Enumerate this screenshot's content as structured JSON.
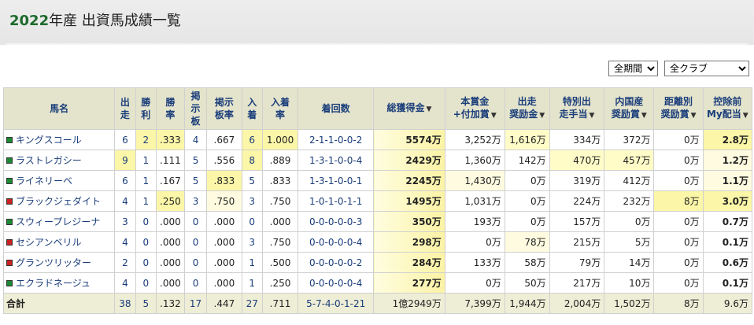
{
  "title": {
    "year": "2022",
    "rest": "年産 出資馬成績一覧"
  },
  "filters": {
    "period": "全期間",
    "club": "全クラブ"
  },
  "headers": [
    {
      "l1": "馬名",
      "l2": ""
    },
    {
      "l1": "出",
      "l2": "走"
    },
    {
      "l1": "勝",
      "l2": "利"
    },
    {
      "l1": "勝",
      "l2": "率"
    },
    {
      "l1": "掲",
      "l2": "示",
      "l3": "板"
    },
    {
      "l1": "掲示",
      "l2": "板率"
    },
    {
      "l1": "入",
      "l2": "着"
    },
    {
      "l1": "入着",
      "l2": "率"
    },
    {
      "l1": "着回数",
      "l2": ""
    },
    {
      "l1": "総獲得金",
      "l2": ""
    },
    {
      "l1": "本賞金",
      "l2": "+付加賞"
    },
    {
      "l1": "出走",
      "l2": "奨励金"
    },
    {
      "l1": "特別出",
      "l2": "走手当"
    },
    {
      "l1": "内国産",
      "l2": "奨励賞"
    },
    {
      "l1": "距離別",
      "l2": "奨励賞"
    },
    {
      "l1": "控除前",
      "l2": "My配当"
    }
  ],
  "sort_mark": "▼",
  "rows": [
    {
      "color": "g",
      "name": "キングスコール",
      "starts": "6",
      "wins": "2",
      "winrate": ".333",
      "board": "4",
      "boardrate": ".667",
      "placed": "6",
      "placerate": "1.000",
      "record": "2-1-1-0-0-2",
      "total": "5574万",
      "prize": "3,252万",
      "start_bonus": "1,616万",
      "special": "334万",
      "domestic": "372万",
      "distance": "0万",
      "dividend": "2.8万"
    },
    {
      "color": "g",
      "name": "ラストレガシー",
      "starts": "9",
      "wins": "1",
      "winrate": ".111",
      "board": "5",
      "boardrate": ".556",
      "placed": "8",
      "placerate": ".889",
      "record": "1-3-1-0-0-4",
      "total": "2429万",
      "prize": "1,360万",
      "start_bonus": "142万",
      "special": "470万",
      "domestic": "457万",
      "distance": "0万",
      "dividend": "1.2万"
    },
    {
      "color": "g",
      "name": "ライネリーベ",
      "starts": "6",
      "wins": "1",
      "winrate": ".167",
      "board": "5",
      "boardrate": ".833",
      "placed": "5",
      "placerate": ".833",
      "record": "1-3-1-0-0-1",
      "total": "2245万",
      "prize": "1,430万",
      "start_bonus": "0万",
      "special": "319万",
      "domestic": "412万",
      "distance": "0万",
      "dividend": "1.1万"
    },
    {
      "color": "r",
      "name": "ブラックジェダイト",
      "starts": "4",
      "wins": "1",
      "winrate": ".250",
      "board": "3",
      "boardrate": ".750",
      "placed": "3",
      "placerate": ".750",
      "record": "1-0-1-0-1-1",
      "total": "1495万",
      "prize": "1,031万",
      "start_bonus": "0万",
      "special": "224万",
      "domestic": "232万",
      "distance": "8万",
      "dividend": "3.0万"
    },
    {
      "color": "g",
      "name": "スウィープレジーナ",
      "starts": "3",
      "wins": "0",
      "winrate": ".000",
      "board": "0",
      "boardrate": ".000",
      "placed": "0",
      "placerate": ".000",
      "record": "0-0-0-0-0-3",
      "total": "350万",
      "prize": "193万",
      "start_bonus": "0万",
      "special": "157万",
      "domestic": "0万",
      "distance": "0万",
      "dividend": "0.7万"
    },
    {
      "color": "r",
      "name": "セシアンベリル",
      "starts": "4",
      "wins": "0",
      "winrate": ".000",
      "board": "0",
      "boardrate": ".000",
      "placed": "3",
      "placerate": ".750",
      "record": "0-0-0-0-0-4",
      "total": "298万",
      "prize": "0万",
      "start_bonus": "78万",
      "special": "215万",
      "domestic": "5万",
      "distance": "0万",
      "dividend": "0.1万"
    },
    {
      "color": "r",
      "name": "グランツリッター",
      "starts": "2",
      "wins": "0",
      "winrate": ".000",
      "board": "0",
      "boardrate": ".000",
      "placed": "1",
      "placerate": ".500",
      "record": "0-0-0-0-0-2",
      "total": "284万",
      "prize": "133万",
      "start_bonus": "58万",
      "special": "79万",
      "domestic": "14万",
      "distance": "0万",
      "dividend": "0.6万"
    },
    {
      "color": "g",
      "name": "エクラドネージュ",
      "starts": "4",
      "wins": "0",
      "winrate": ".000",
      "board": "0",
      "boardrate": ".000",
      "placed": "1",
      "placerate": ".250",
      "record": "0-0-0-0-0-4",
      "total": "277万",
      "prize": "0万",
      "start_bonus": "50万",
      "special": "217万",
      "domestic": "10万",
      "distance": "0万",
      "dividend": "0.1万"
    }
  ],
  "total": {
    "name": "合計",
    "starts": "38",
    "wins": "5",
    "winrate": ".132",
    "board": "17",
    "boardrate": ".447",
    "placed": "27",
    "placerate": ".711",
    "record": "5-7-4-0-1-21",
    "total": "1億2949万",
    "prize": "7,399万",
    "start_bonus": "1,944万",
    "special": "2,004万",
    "domestic": "1,502万",
    "distance": "8万",
    "dividend": "9.6万"
  },
  "colors": {
    "header_bg": "#e4e4cc",
    "link": "#1a3d7a",
    "highlight": "#fbf6a8",
    "green_silk": "#1c8a33",
    "red_silk": "#cc2222"
  }
}
